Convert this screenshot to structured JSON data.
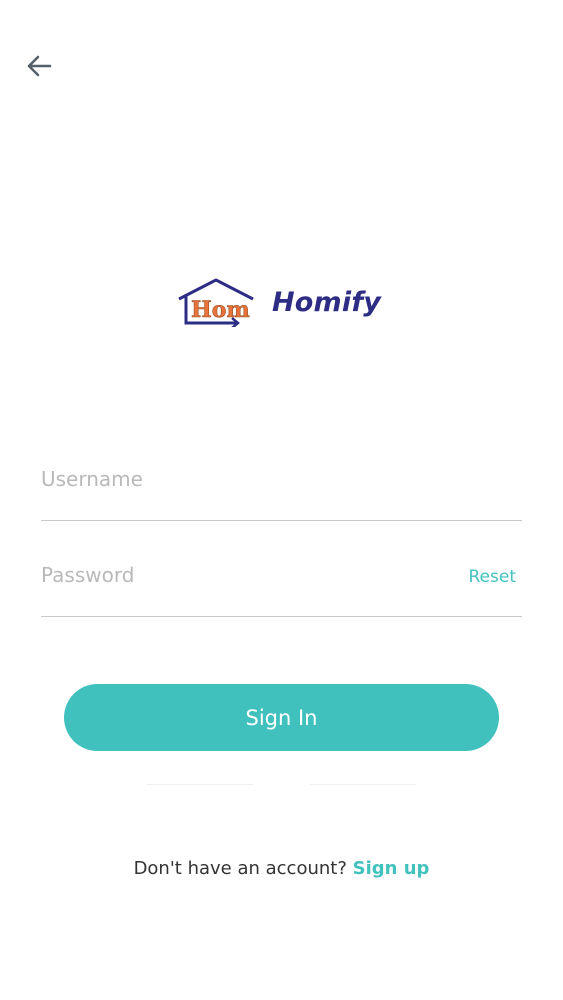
{
  "app": {
    "brand_name": "Homify",
    "logo_mark_text": "Hom"
  },
  "colors": {
    "accent": "#40c1be",
    "brand": "#2e2d86",
    "logo_orange": "#e8743b",
    "text": "#333333",
    "placeholder": "#b9b9b9",
    "divider": "#c8c8c8"
  },
  "header": {
    "back_icon": "arrow-left-icon"
  },
  "form": {
    "username": {
      "placeholder": "Username",
      "value": ""
    },
    "password": {
      "placeholder": "Password",
      "value": ""
    },
    "reset_label": "Reset",
    "sign_in_label": "Sign In"
  },
  "footer": {
    "prompt": "Don't have an account?",
    "sign_up_label": "Sign up"
  }
}
